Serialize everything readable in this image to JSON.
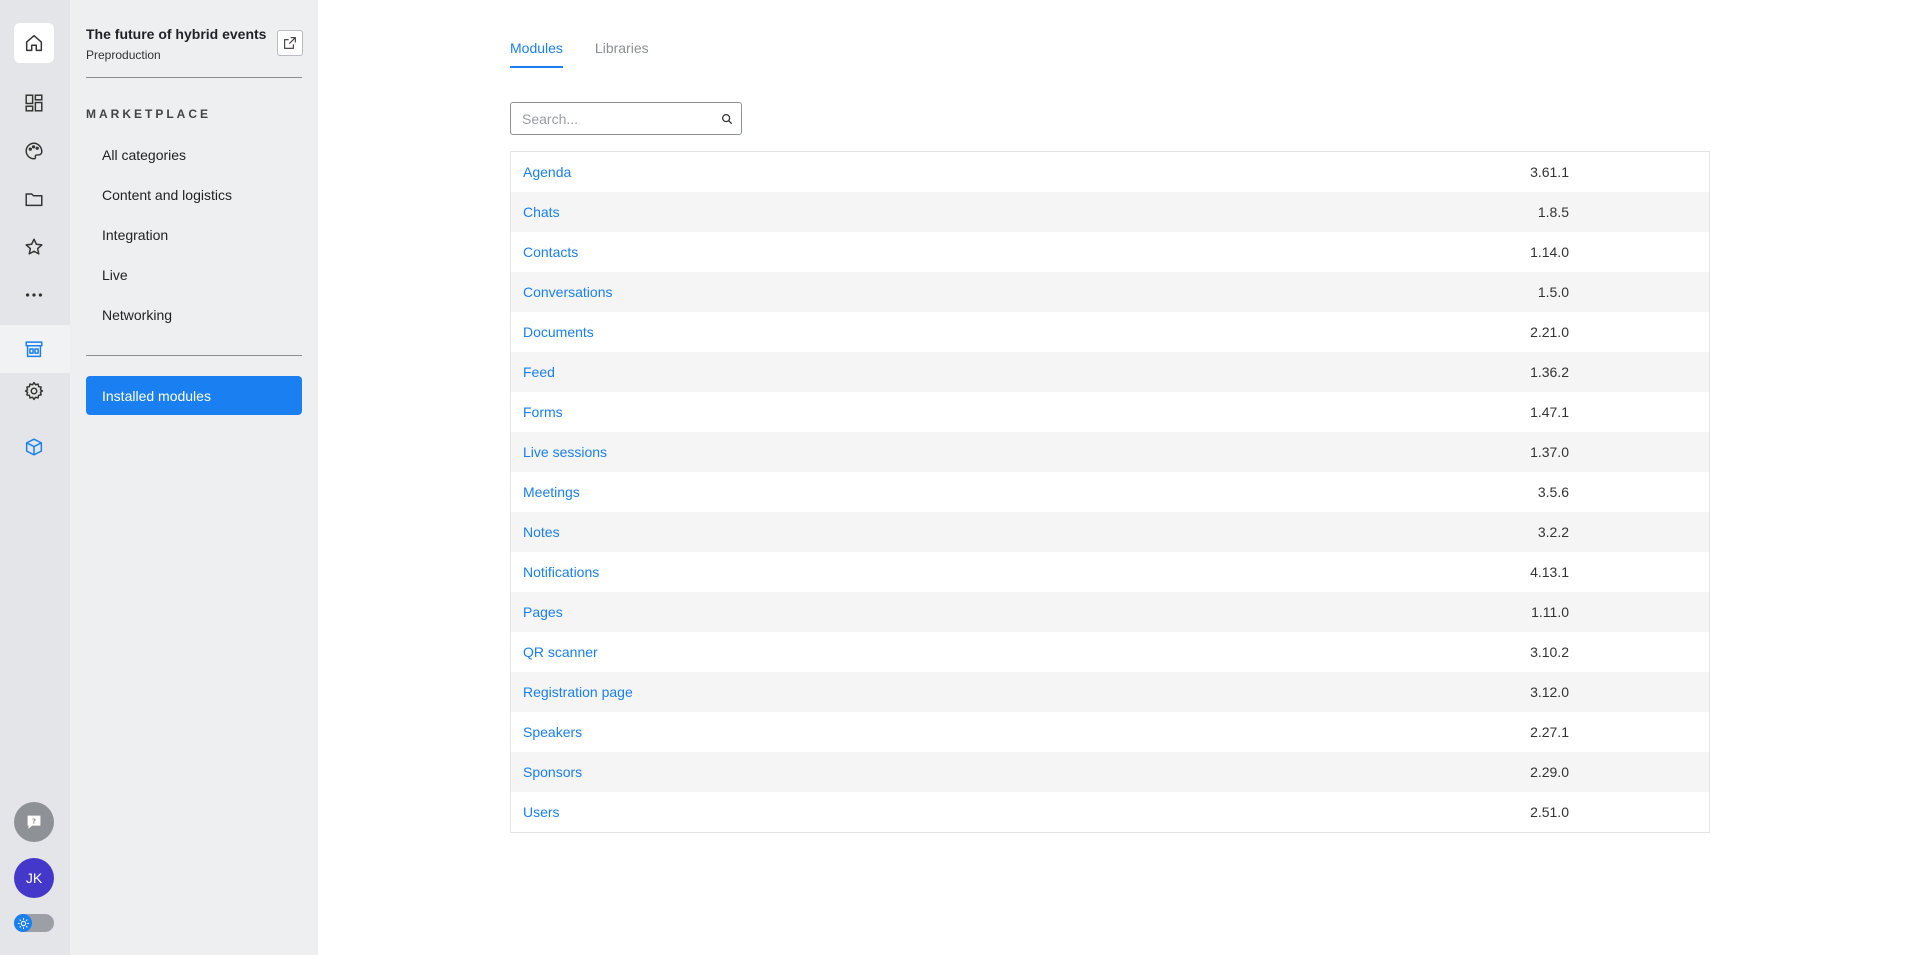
{
  "rail": {
    "icons": [
      "home-icon",
      "dashboard-icon",
      "palette-icon",
      "folder-icon",
      "star-icon",
      "more-icon",
      "marketplace-icon",
      "gear-icon",
      "cube-icon"
    ],
    "avatar_initials": "JK",
    "accent": "#1a7ff0"
  },
  "sidebar": {
    "event_title": "The future of hybrid events",
    "event_subtitle": "Preproduction",
    "section_label": "MARKETPLACE",
    "items": [
      {
        "label": "All categories"
      },
      {
        "label": "Content and logistics"
      },
      {
        "label": "Integration"
      },
      {
        "label": "Live"
      },
      {
        "label": "Networking"
      }
    ],
    "installed_button": "Installed modules"
  },
  "main": {
    "tabs": [
      {
        "label": "Modules",
        "active": true
      },
      {
        "label": "Libraries",
        "active": false
      }
    ],
    "search": {
      "placeholder": "Search...",
      "value": ""
    },
    "modules": [
      {
        "name": "Agenda",
        "version": "3.61.1"
      },
      {
        "name": "Chats",
        "version": "1.8.5"
      },
      {
        "name": "Contacts",
        "version": "1.14.0"
      },
      {
        "name": "Conversations",
        "version": "1.5.0"
      },
      {
        "name": "Documents",
        "version": "2.21.0"
      },
      {
        "name": "Feed",
        "version": "1.36.2"
      },
      {
        "name": "Forms",
        "version": "1.47.1"
      },
      {
        "name": "Live sessions",
        "version": "1.37.0"
      },
      {
        "name": "Meetings",
        "version": "3.5.6"
      },
      {
        "name": "Notes",
        "version": "3.2.2"
      },
      {
        "name": "Notifications",
        "version": "4.13.1"
      },
      {
        "name": "Pages",
        "version": "1.11.0"
      },
      {
        "name": "QR scanner",
        "version": "3.10.2"
      },
      {
        "name": "Registration page",
        "version": "3.12.0"
      },
      {
        "name": "Speakers",
        "version": "2.27.1"
      },
      {
        "name": "Sponsors",
        "version": "2.29.0"
      },
      {
        "name": "Users",
        "version": "2.51.0"
      }
    ]
  }
}
